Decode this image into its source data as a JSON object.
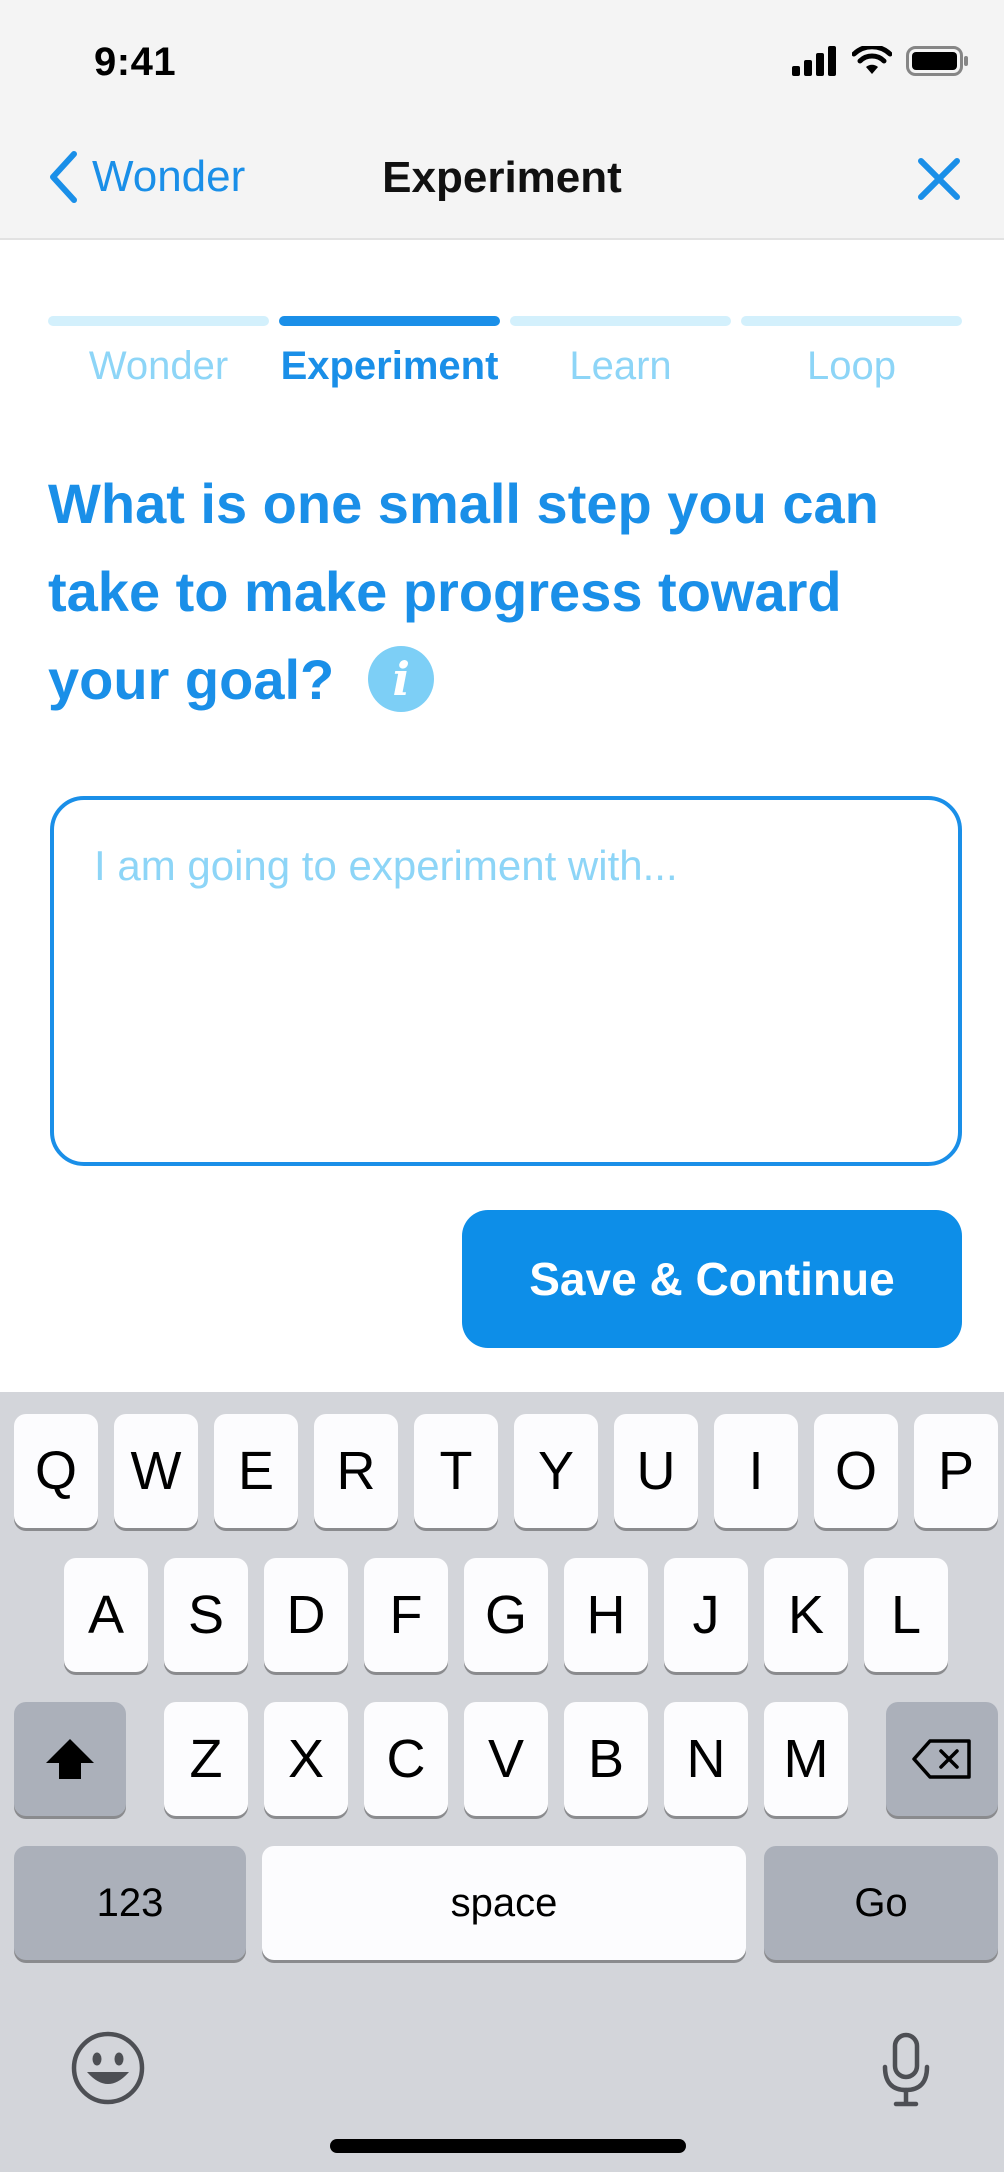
{
  "status_bar": {
    "time": "9:41"
  },
  "nav": {
    "back_label": "Wonder",
    "title": "Experiment"
  },
  "stepper": {
    "steps": [
      {
        "label": "Wonder",
        "active": false
      },
      {
        "label": "Experiment",
        "active": true
      },
      {
        "label": "Learn",
        "active": false
      },
      {
        "label": "Loop",
        "active": false
      }
    ]
  },
  "question": {
    "text": "What is one small step you can take to make progress toward your goal?",
    "info_glyph": "i"
  },
  "answer": {
    "placeholder": "I am going to experiment with...",
    "value": ""
  },
  "actions": {
    "save_label": "Save & Continue"
  },
  "keyboard": {
    "row1": [
      "Q",
      "W",
      "E",
      "R",
      "T",
      "Y",
      "U",
      "I",
      "O",
      "P"
    ],
    "row2": [
      "A",
      "S",
      "D",
      "F",
      "G",
      "H",
      "J",
      "K",
      "L"
    ],
    "row3": [
      "Z",
      "X",
      "C",
      "V",
      "B",
      "N",
      "M"
    ],
    "numbers_label": "123",
    "space_label": "space",
    "go_label": "Go",
    "icons": {
      "shift": "shift-icon",
      "delete": "backspace-icon",
      "emoji": "emoji-icon",
      "dictation": "microphone-icon"
    }
  },
  "colors": {
    "accent": "#1a8fe8",
    "accent_light": "#8dd5f7",
    "track": "#d3f0fc",
    "button": "#0d8ee8"
  }
}
